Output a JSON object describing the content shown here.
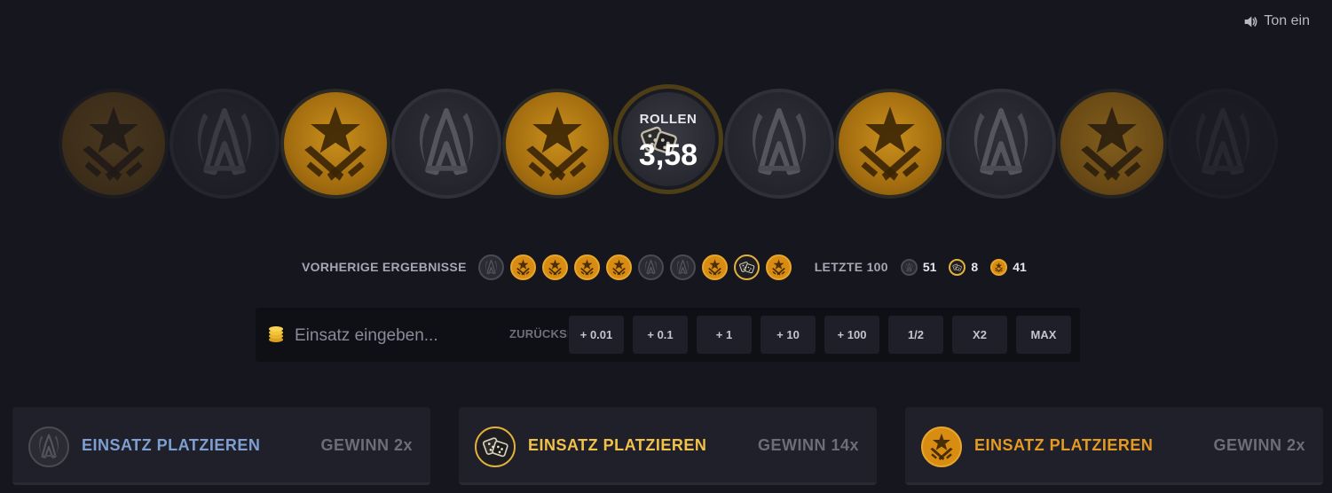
{
  "sound": {
    "label": "Ton ein",
    "icon": "speaker-icon"
  },
  "roller": {
    "label": "ROLLEN",
    "value": "3,58",
    "strip": [
      "t",
      "ct",
      "t",
      "ct",
      "t",
      "dice",
      "ct",
      "t",
      "ct",
      "t",
      "ct"
    ]
  },
  "history": {
    "label": "VORHERIGE ERGEBNISSE",
    "results": [
      "ct",
      "t",
      "t",
      "t",
      "t",
      "ct",
      "ct",
      "t",
      "dice",
      "t"
    ],
    "last100_label": "LETZTE 100",
    "stats": [
      {
        "type": "ct",
        "count": "51"
      },
      {
        "type": "dice",
        "count": "8"
      },
      {
        "type": "t",
        "count": "41"
      }
    ]
  },
  "bet": {
    "placeholder": "Einsatz eingeben...",
    "reset_label": "ZURÜCKSETZEN",
    "buttons": [
      "+ 0.01",
      "+ 0.1",
      "+ 1",
      "+ 10",
      "+ 100",
      "1/2",
      "X2",
      "MAX"
    ]
  },
  "panels": [
    {
      "type": "ct",
      "title": "EINSATZ PLATZIEREN",
      "payout": "GEWINN 2x",
      "color": "#7e9fd2"
    },
    {
      "type": "dice",
      "title": "EINSATZ PLATZIEREN",
      "payout": "GEWINN 14x",
      "color": "#f2c14a"
    },
    {
      "type": "t",
      "title": "EINSATZ PLATZIEREN",
      "payout": "GEWINN 2x",
      "color": "#e59a22"
    }
  ],
  "colors": {
    "background": "#16161f",
    "t_gold": "#d98c12",
    "ct_gray": "#2b2b33",
    "dice_gold": "#e2b23a"
  }
}
